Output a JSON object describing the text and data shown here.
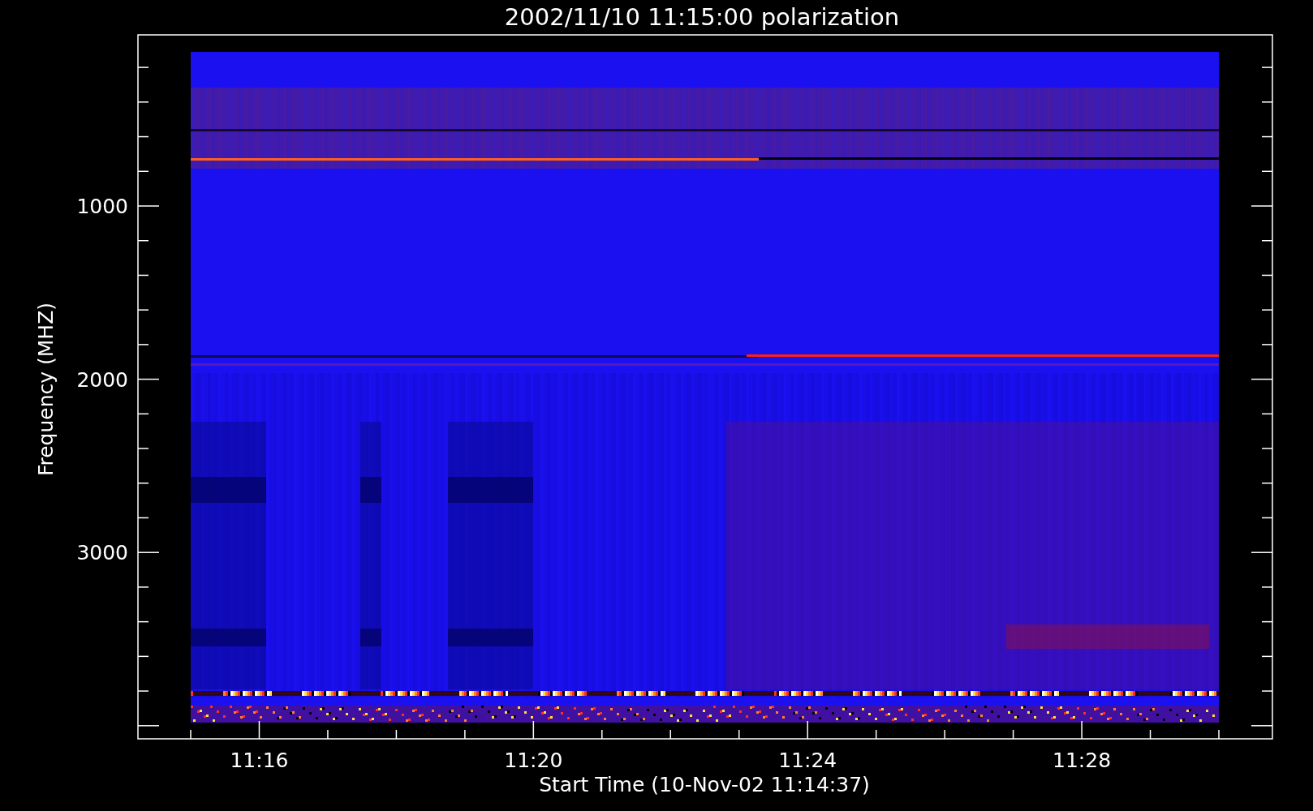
{
  "title": "2002/11/10 11:15:00 polarization",
  "x_axis": {
    "label": "Start Time (10-Nov-02 11:14:37)",
    "ticks": [
      "11:16",
      "11:20",
      "11:24",
      "11:28"
    ]
  },
  "y_axis": {
    "label": "Frequency (MHZ)",
    "ticks": [
      "1000",
      "2000",
      "3000"
    ]
  }
}
